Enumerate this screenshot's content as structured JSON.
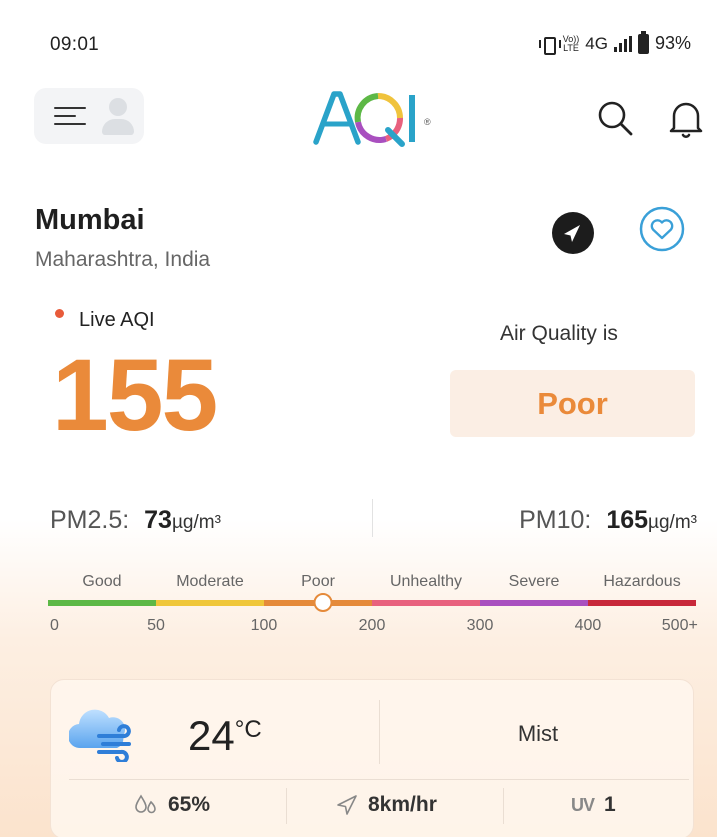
{
  "status_bar": {
    "time": "09:01",
    "network": "4G",
    "volte_top": "Vo))",
    "volte_bottom": "LTE",
    "battery": "93%"
  },
  "header": {
    "logo_text": "AQI",
    "logo_mark": "®",
    "menu_icon": "hamburger-icon",
    "avatar_icon": "user-avatar-icon",
    "search_icon": "search-icon",
    "notification_icon": "bell-icon"
  },
  "location": {
    "city": "Mumbai",
    "region": "Maharashtra, India",
    "navigate_icon": "navigation-arrow-icon",
    "favorite_icon": "heart-icon"
  },
  "aqi": {
    "live_label": "Live AQI",
    "value": "155",
    "air_quality_label": "Air Quality is",
    "status": "Poor",
    "status_color": "#ea8a3a"
  },
  "pollutants": {
    "pm25_label": "PM2.5:",
    "pm25_value": "73",
    "pm25_unit": "µg/m³",
    "pm10_label": "PM10:",
    "pm10_value": "165",
    "pm10_unit": "µg/m³"
  },
  "scale": {
    "categories": [
      "Good",
      "Moderate",
      "Poor",
      "Unhealthy",
      "Severe",
      "Hazardous"
    ],
    "colors": [
      "#5db846",
      "#efc63a",
      "#e58a3a",
      "#e8617e",
      "#a94fbf",
      "#c8283a"
    ],
    "ticks": [
      "0",
      "50",
      "100",
      "200",
      "300",
      "400",
      "500+"
    ],
    "marker_value": 155
  },
  "weather": {
    "icon": "cloud-wind-icon",
    "temperature": "24",
    "temperature_unit": "°C",
    "condition": "Mist",
    "humidity_icon": "humidity-drops-icon",
    "humidity": "65%",
    "wind_icon": "wind-direction-icon",
    "wind": "8km/hr",
    "uv_label": "UV",
    "uv": "1"
  }
}
